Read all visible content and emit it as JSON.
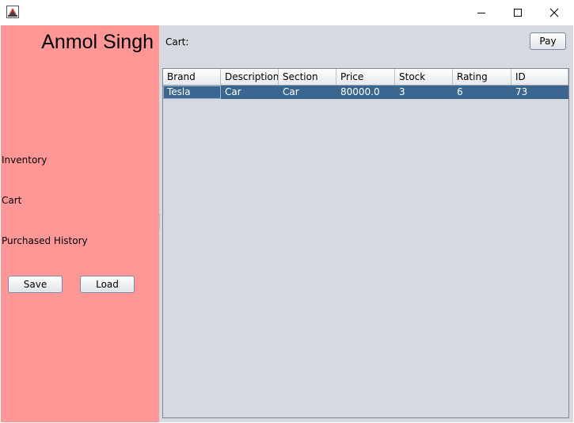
{
  "window": {
    "app_icon": "java-app-icon",
    "controls": [
      "minimize-icon",
      "maximize-icon",
      "close-icon"
    ]
  },
  "sidebar": {
    "user_name": "Anmol Singh",
    "nav": {
      "inventory": "Inventory",
      "cart": "Cart",
      "purchased_history": "Purchased History"
    },
    "save_label": "Save",
    "load_label": "Load",
    "background_color": "#ff9797"
  },
  "main": {
    "cart_label": "Cart:",
    "pay_label": "Pay",
    "background_color": "#d6d9df",
    "table": {
      "columns": [
        "Brand",
        "Description",
        "Section",
        "Price",
        "Stock",
        "Rating",
        "ID"
      ],
      "rows": [
        [
          "Tesla",
          "Car",
          "Car",
          "80000.0",
          "3",
          "6",
          "73"
        ]
      ],
      "selected_row_color": "#3b6690"
    }
  }
}
